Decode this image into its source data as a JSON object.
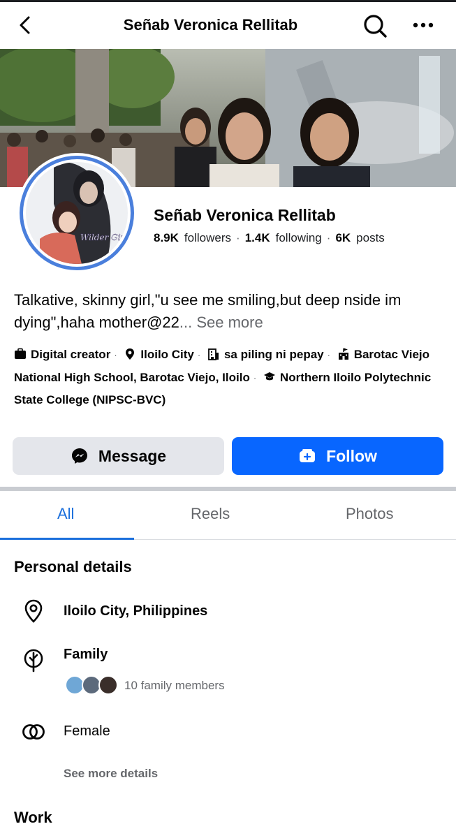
{
  "header": {
    "title": "Señab Veronica Rellitab",
    "back_icon": "chevron-left-icon",
    "search_icon": "search-icon",
    "more_icon": "more-horizontal-icon"
  },
  "profile": {
    "name": "Señab Veronica Rellitab",
    "avatar_text": "Wilder Girl's Heart",
    "followers_count": "8.9K",
    "followers_label": "followers",
    "following_count": "1.4K",
    "following_label": "following",
    "posts_count": "6K",
    "posts_label": "posts",
    "bio": "Talkative, skinny girl,\"u see me smiling,but deep nside im dying\",haha mother@22",
    "bio_ellipsis": "...",
    "see_more": "See more"
  },
  "intro": {
    "items": [
      {
        "icon": "briefcase-icon",
        "text": "Digital creator"
      },
      {
        "icon": "location-pin-icon",
        "text": "Iloilo City"
      },
      {
        "icon": "building-icon",
        "text": "sa piling ni pepay"
      },
      {
        "icon": "school-icon",
        "text": "Barotac Viejo National High School, Barotac Viejo, Iloilo"
      },
      {
        "icon": "graduation-cap-icon",
        "text": "Northern Iloilo Polytechnic State College (NIPSC-BVC)"
      }
    ]
  },
  "actions": {
    "message_label": "Message",
    "message_icon": "messenger-icon",
    "follow_label": "Follow",
    "follow_icon": "add-friend-icon"
  },
  "tabs": [
    {
      "label": "All",
      "active": true
    },
    {
      "label": "Reels",
      "active": false
    },
    {
      "label": "Photos",
      "active": false
    }
  ],
  "personal_details": {
    "title": "Personal details",
    "location": "Iloilo City, Philippines",
    "family_label": "Family",
    "family_members": "10 family members",
    "gender": "Female",
    "see_more_details": "See more details"
  },
  "work": {
    "title": "Work"
  },
  "colors": {
    "accent": "#0866ff",
    "tab_active": "#1b6fdc",
    "secondary_button": "#e4e6eb",
    "muted_text": "#65676b",
    "avatar_ring": "#4a7fdc"
  }
}
